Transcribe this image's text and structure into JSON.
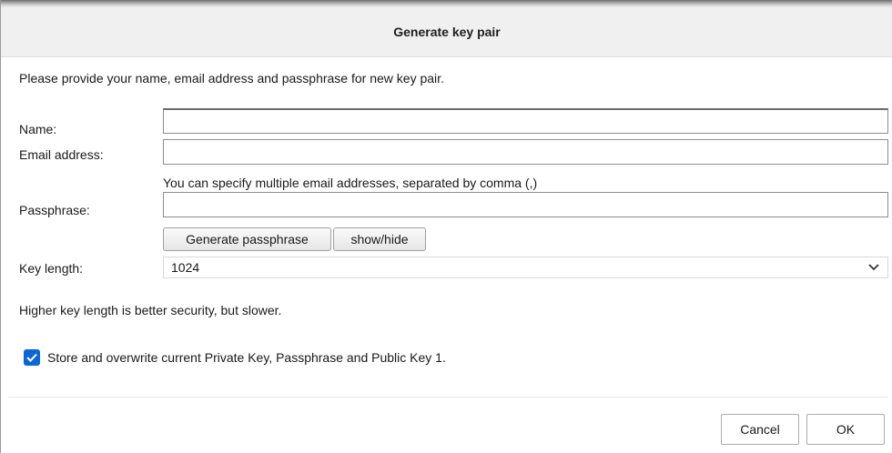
{
  "dialog": {
    "title": "Generate key pair",
    "intro": "Please provide your name, email address and passphrase for new key pair."
  },
  "form": {
    "name_label": "Name:",
    "name_value": "",
    "email_label": "Email address:",
    "email_value": "",
    "email_hint": "You can specify multiple email addresses, separated by comma (,)",
    "passphrase_label": "Passphrase:",
    "passphrase_value": "",
    "generate_passphrase_label": "Generate passphrase",
    "show_hide_label": "show/hide",
    "key_length_label": "Key length:",
    "key_length_value": "1024",
    "key_length_note": "Higher key length is better security, but slower.",
    "store_checkbox_label": "Store and overwrite current Private Key, Passphrase and Public Key 1.",
    "store_checked": true
  },
  "buttons": {
    "cancel": "Cancel",
    "ok": "OK"
  },
  "icons": {
    "dropdown": "chevron-down-icon",
    "checkbox": "checkmark-icon"
  },
  "colors": {
    "accent": "#0b66d6",
    "titlebar": "#f0f0f0"
  }
}
